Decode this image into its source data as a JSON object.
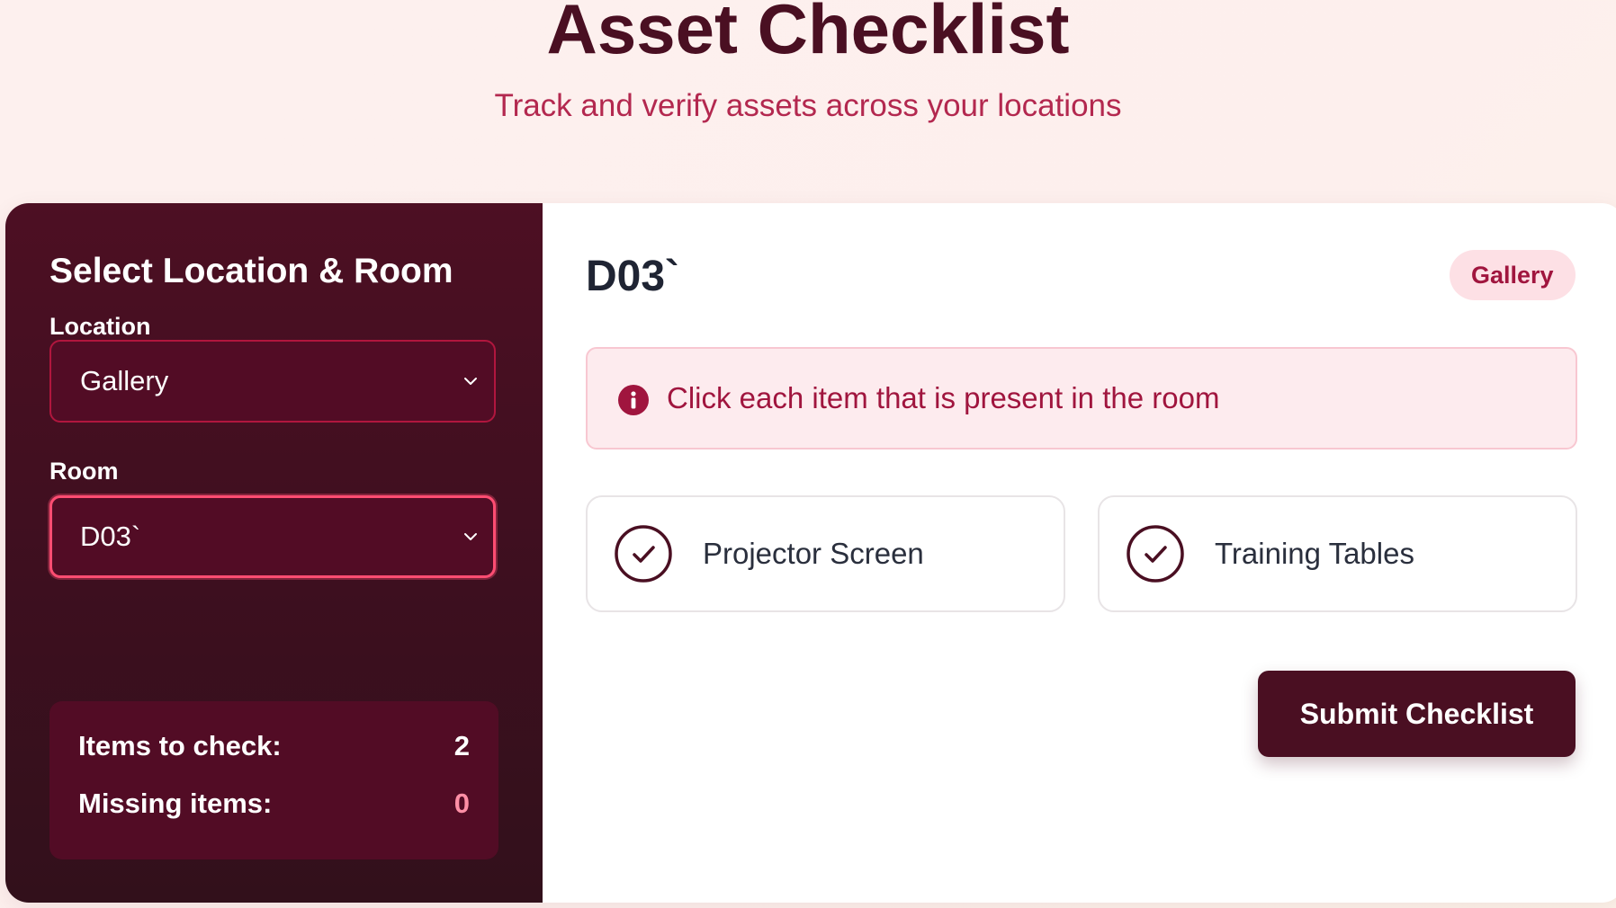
{
  "header": {
    "title": "Asset Checklist",
    "subtitle": "Track and verify assets across your locations"
  },
  "sidebar": {
    "title": "Select Location & Room",
    "location": {
      "label": "Location",
      "value": "Gallery"
    },
    "room": {
      "label": "Room",
      "value": "D03`"
    },
    "stats": {
      "items_label": "Items to check:",
      "items_value": "2",
      "missing_label": "Missing items:",
      "missing_value": "0"
    }
  },
  "main": {
    "room_title": "D03`",
    "location_badge": "Gallery",
    "info_text": "Click each item that is present in the room",
    "items": [
      {
        "label": "Projector Screen",
        "checked": false
      },
      {
        "label": "Training Tables",
        "checked": false
      }
    ],
    "submit_label": "Submit Checklist"
  },
  "icons": {
    "chevron": "chevron-down-icon",
    "info": "info-icon",
    "check": "check-circle-icon"
  },
  "colors": {
    "brand_dark": "#4a0f22",
    "accent": "#a0153e",
    "focus": "#ff4d72",
    "missing": "#ff8fa6"
  }
}
